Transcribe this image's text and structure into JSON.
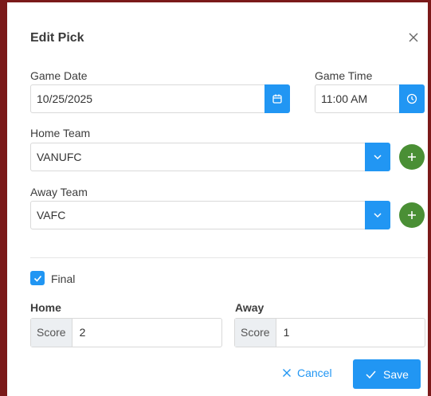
{
  "dialog": {
    "title": "Edit Pick"
  },
  "game_date": {
    "label": "Game Date",
    "value": "10/25/2025"
  },
  "game_time": {
    "label": "Game Time",
    "value": "11:00 AM"
  },
  "home_team": {
    "label": "Home Team",
    "value": "VANUFC"
  },
  "away_team": {
    "label": "Away Team",
    "value": "VAFC"
  },
  "final": {
    "label": "Final",
    "checked": true
  },
  "home_score": {
    "label": "Home",
    "addon": "Score",
    "value": "2"
  },
  "away_score": {
    "label": "Away",
    "addon": "Score",
    "value": "1"
  },
  "actions": {
    "cancel_label": "Cancel",
    "save_label": "Save"
  },
  "icons": {
    "close": "close-icon",
    "calendar": "calendar-icon",
    "clock": "clock-icon",
    "chevron": "chevron-down-icon",
    "add": "plus-icon",
    "check": "check-icon"
  },
  "colors": {
    "accent": "#2196f3",
    "add_button": "#4a8f35",
    "frame": "#7b1a1a"
  }
}
